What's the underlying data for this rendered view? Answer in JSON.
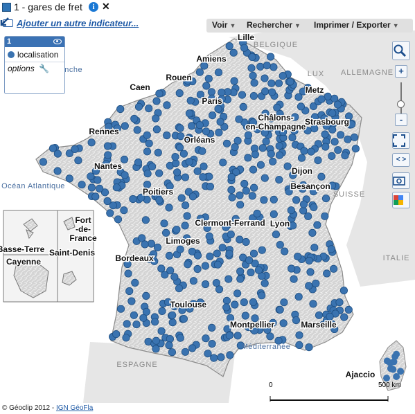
{
  "header": {
    "title": "1 - gares de fret",
    "swatch_color": "#2f74b5",
    "info_icon": "info-icon",
    "close_icon": "close-icon"
  },
  "toolbar": {
    "add_indicator": "Ajouter un autre indicateur...",
    "menus": [
      "Voir",
      "Rechercher",
      "Imprimer / Exporter"
    ]
  },
  "legend": {
    "number": "1",
    "item_label": "localisation",
    "item_color": "#3a73b0",
    "options_label": "options"
  },
  "map": {
    "cities": [
      "Lille",
      "Amiens",
      "Rouen",
      "Caen",
      "Paris",
      "Metz",
      "Châlons-en-Champagne",
      "Strasbourg",
      "Rennes",
      "Orléans",
      "Nantes",
      "Dijon",
      "Besançon",
      "Poitiers",
      "Clermont-Ferrand",
      "Lyon",
      "Limoges",
      "Bordeaux",
      "Toulouse",
      "Montpellier",
      "Marseille",
      "Ajaccio"
    ],
    "neighbors": [
      "BELGIQUE",
      "LUX",
      "ALLEMAGNE",
      "SUISSE",
      "ITALIE",
      "ESPAGNE"
    ],
    "seas": [
      "Manche",
      "Océan Atlantique",
      "Méditerranée"
    ],
    "overseas": [
      "Fort-de-France",
      "Basse-Terre",
      "Cayenne",
      "Saint-Denis"
    ],
    "scale": {
      "start": "0",
      "end": "500 km"
    },
    "point_color": "#3a73b0"
  },
  "tools": {
    "zoom_in": "+",
    "zoom_out": "-",
    "icons": [
      "magnifier-icon",
      "fullscreen-icon",
      "pan-arrows-icon",
      "camera-icon",
      "google-icon"
    ]
  },
  "footer": {
    "copyright": "© Géoclip 2012 - ",
    "source_link": "IGN GéoFla"
  }
}
